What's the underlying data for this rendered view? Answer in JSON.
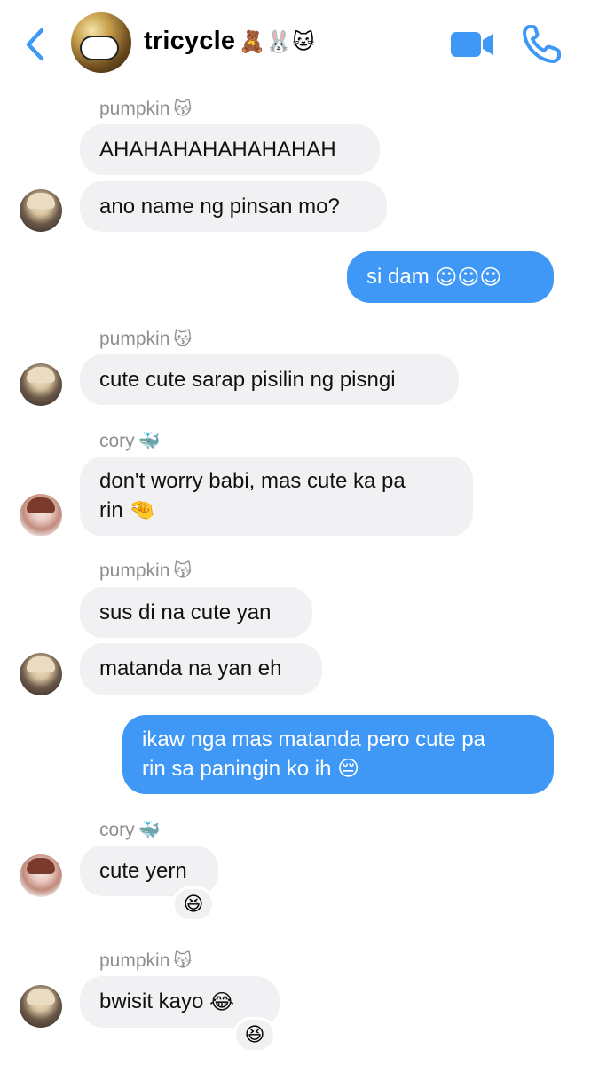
{
  "header": {
    "title": "tricycle",
    "title_emoji": "🧸🐰🐱",
    "back_icon": "chevron-left-icon",
    "video_icon": "video-camera-icon",
    "phone_icon": "phone-icon"
  },
  "colors": {
    "accent": "#3f97f6",
    "incoming_bubble": "#f1f1f4",
    "sender_name": "#8e8e93"
  },
  "messages": [
    {
      "sender": "pumpkin",
      "sender_emoji": "😽",
      "text": "AHAHAHAHAHAHAHAH"
    },
    {
      "text": "ano name ng pinsan mo?"
    },
    {
      "outgoing": true,
      "text": "si dam",
      "emoji": "☺☺☺"
    },
    {
      "sender": "pumpkin",
      "sender_emoji": "😽",
      "text": "cute cute sarap pisilin ng pisngi"
    },
    {
      "sender": "cory",
      "sender_emoji": "🐳",
      "line1": "don't worry babi, mas cute ka pa",
      "line2": "rin",
      "emoji": "🤏"
    },
    {
      "sender": "pumpkin",
      "sender_emoji": "😽",
      "text": "sus di na cute yan"
    },
    {
      "text": "matanda na yan eh"
    },
    {
      "outgoing": true,
      "line1": "ikaw nga mas matanda pero cute pa",
      "line2": "rin sa paningin ko ih",
      "emoji": "😔"
    },
    {
      "sender": "cory",
      "sender_emoji": "🐳",
      "text": "cute yern",
      "reaction": "😆"
    },
    {
      "sender": "pumpkin",
      "sender_emoji": "😽",
      "text": "bwisit kayo",
      "emoji": "😂",
      "reaction": "😆"
    }
  ]
}
